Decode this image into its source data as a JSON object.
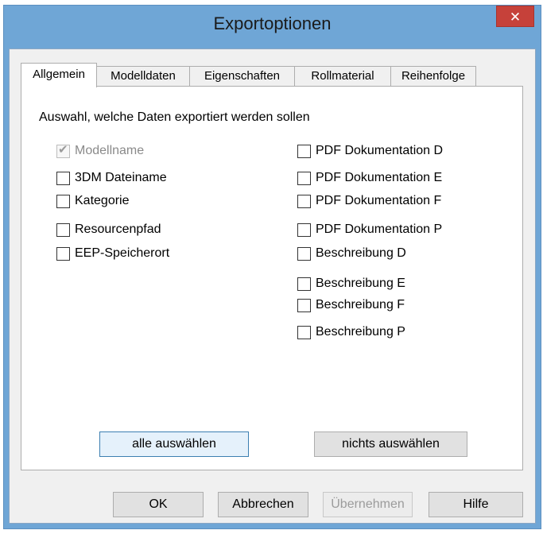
{
  "window": {
    "title": "Exportoptionen",
    "close_glyph": "✕"
  },
  "tabs": [
    {
      "label": "Allgemein",
      "active": true
    },
    {
      "label": "Modelldaten",
      "active": false
    },
    {
      "label": "Eigenschaften",
      "active": false
    },
    {
      "label": "Rollmaterial",
      "active": false
    },
    {
      "label": "Reihenfolge",
      "active": false
    }
  ],
  "panel": {
    "section_label": "Auswahl, welche Daten exportiert werden sollen",
    "left_checkboxes": [
      {
        "label": "Modellname",
        "checked": true,
        "disabled": true
      },
      {
        "label": "3DM Dateiname",
        "checked": false,
        "disabled": false
      },
      {
        "label": "Kategorie",
        "checked": false,
        "disabled": false
      },
      {
        "label": "Resourcenpfad",
        "checked": false,
        "disabled": false
      },
      {
        "label": "EEP-Speicherort",
        "checked": false,
        "disabled": false
      }
    ],
    "right_checkboxes": [
      {
        "label": "PDF Dokumentation D",
        "checked": false
      },
      {
        "label": "PDF Dokumentation E",
        "checked": false
      },
      {
        "label": "PDF Dokumentation F",
        "checked": false
      },
      {
        "label": "PDF Dokumentation P",
        "checked": false
      },
      {
        "label": "Beschreibung D",
        "checked": false
      },
      {
        "label": "Beschreibung E",
        "checked": false
      },
      {
        "label": "Beschreibung F",
        "checked": false
      },
      {
        "label": "Beschreibung P",
        "checked": false
      }
    ],
    "select_all_label": "alle auswählen",
    "select_none_label": "nichts auswählen"
  },
  "footer": {
    "ok_label": "OK",
    "cancel_label": "Abbrechen",
    "apply_label": "Übernehmen",
    "apply_disabled": true,
    "help_label": "Hilfe"
  }
}
